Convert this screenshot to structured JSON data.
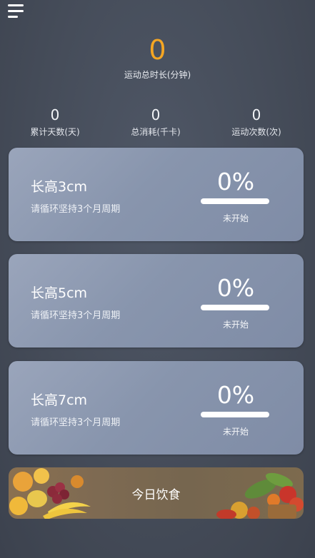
{
  "header": {
    "menu_icon": "hamburger-menu-icon"
  },
  "summary": {
    "total_minutes": "0",
    "total_minutes_label": "运动总时长(分钟)"
  },
  "stats": [
    {
      "value": "0",
      "label": "累计天数(天)"
    },
    {
      "value": "0",
      "label": "总消耗(千卡)"
    },
    {
      "value": "0",
      "label": "运动次数(次)"
    }
  ],
  "plans": [
    {
      "title": "长高3cm",
      "subtitle": "请循环坚持3个月周期",
      "percent": "0%",
      "progress": 0,
      "status": "未开始"
    },
    {
      "title": "长高5cm",
      "subtitle": "请循环坚持3个月周期",
      "percent": "0%",
      "progress": 0,
      "status": "未开始"
    },
    {
      "title": "长高7cm",
      "subtitle": "请循环坚持3个月周期",
      "percent": "0%",
      "progress": 0,
      "status": "未开始"
    }
  ],
  "diet": {
    "label": "今日饮食",
    "icon": "fruit-vegetable-banner"
  },
  "colors": {
    "accent": "#f5a623",
    "background": "#454c59",
    "card": "#8895ad"
  }
}
